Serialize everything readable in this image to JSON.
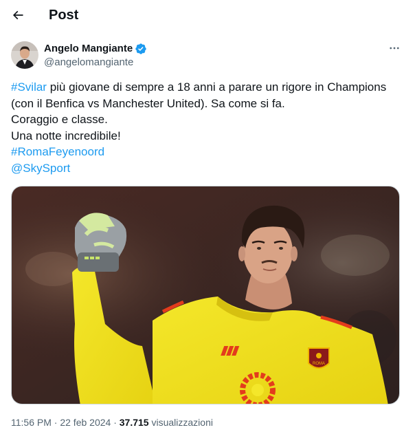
{
  "header": {
    "title": "Post",
    "back_icon": "arrow-left-icon"
  },
  "author": {
    "display_name": "Angelo Mangiante",
    "handle": "@angelomangiante",
    "verified_icon": "verified-badge-icon",
    "more_icon": "more-horizontal-icon"
  },
  "tweet": {
    "line1_hashtag": "#Svilar",
    "line1_text": " più giovane di sempre a 18 anni a parare un rigore in Champions",
    "line2": "(con il Benfica vs Manchester United). Sa come si fa.",
    "line3": "Coraggio e classe.",
    "line4": "Una notte incredibile!",
    "hashtag2": "#RomaFeyenoord",
    "mention": "@SkySport"
  },
  "meta": {
    "time": "11:56 PM",
    "sep1": " · ",
    "date": "22 feb 2024",
    "sep2": " · ",
    "views_count": "37.715",
    "views_label": " visualizzazioni"
  },
  "media": {
    "crest_text": "ROMA"
  },
  "colors": {
    "link": "#1d9bf0",
    "secondary_text": "#536471",
    "verified": "#1d9bf0",
    "jersey": "#f2e21a"
  }
}
